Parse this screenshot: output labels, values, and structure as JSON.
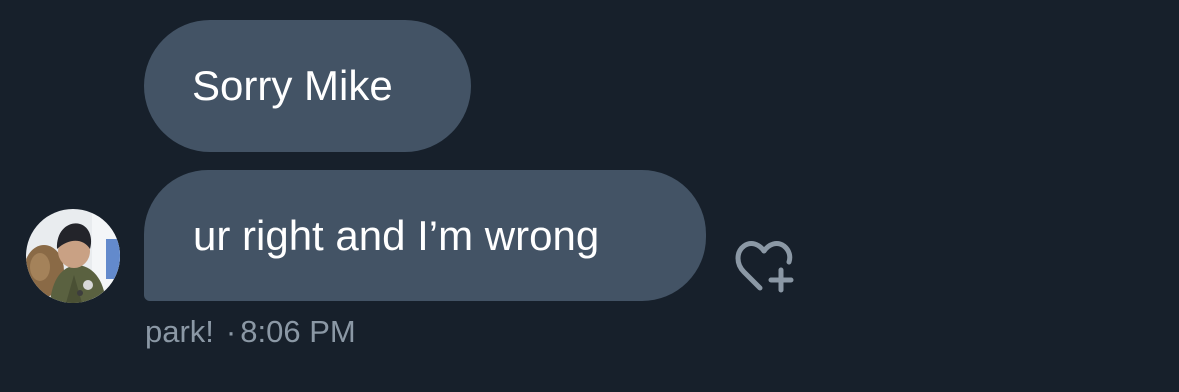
{
  "messages": [
    {
      "text": "Sorry Mike"
    },
    {
      "text": "ur right and I’m wrong"
    }
  ],
  "meta": {
    "sender": "park!",
    "separator": "·",
    "time": "8:06 PM"
  },
  "icons": {
    "avatar": "user-avatar-photo",
    "reaction": "heart-plus-icon"
  },
  "colors": {
    "background": "#17202b",
    "bubble": "#435365",
    "message_text": "#ffffff",
    "meta_text": "#8b98a5"
  }
}
